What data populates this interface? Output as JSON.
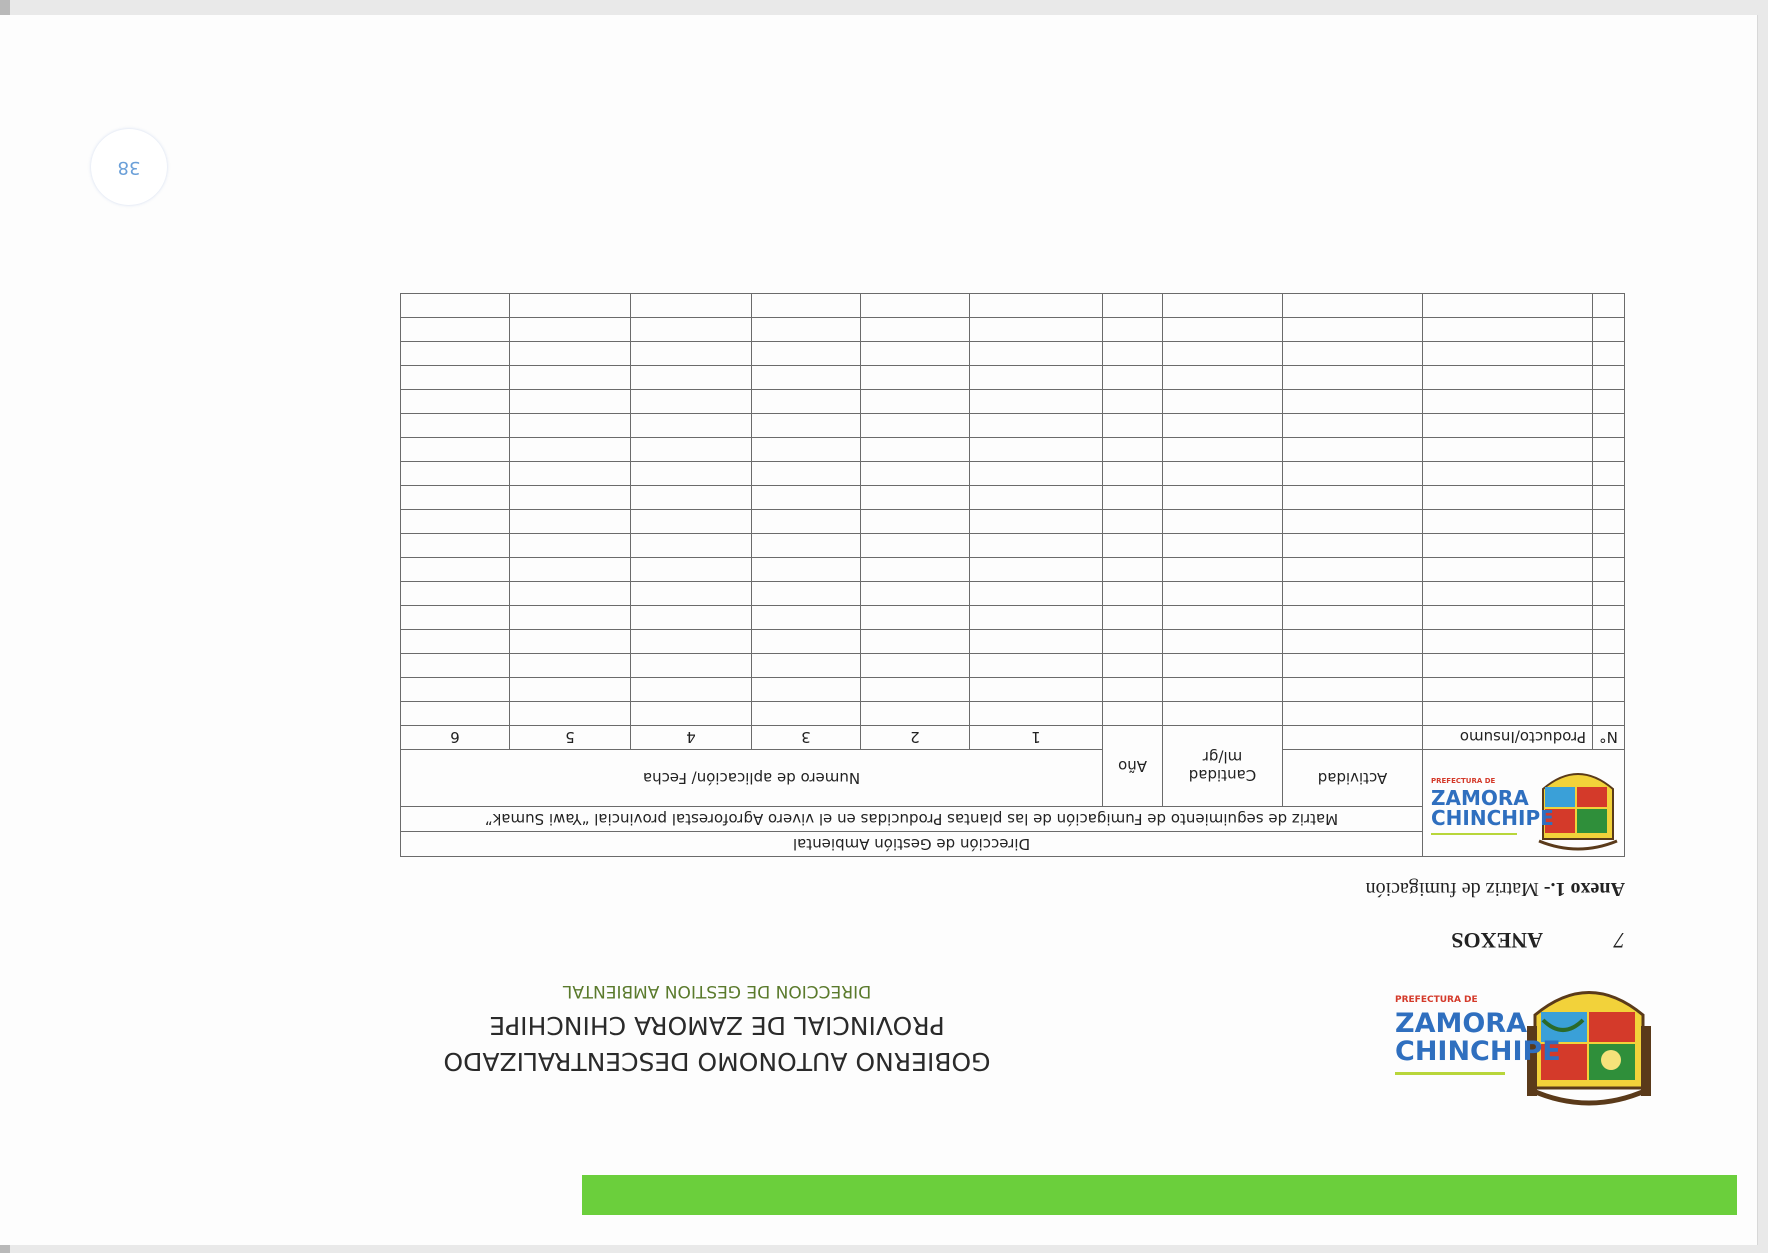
{
  "header": {
    "brand": {
      "prefix": "PREFECTURA DE",
      "line1": "ZAMORA",
      "line2": "CHINCHIPE"
    },
    "title_lines": [
      "GOBIERNO AUTONOMO DESCENTRALIZADO",
      "PROVINCIAL DE ZAMORA CHINCHIPE"
    ],
    "subtitle": "DIRECCION DE GESTION AMBIENTAL"
  },
  "section": {
    "number": "7",
    "title": "ANEXOS"
  },
  "annex": {
    "label": "Anexo 1.-",
    "text": " Matriz de fumigación"
  },
  "matrix": {
    "department": "Dirección de Gestión Ambiental",
    "title": "Matriz de seguimiento de Fumigación de las plantas Producidas en el vivero Agroforestal provincial “Yawi Sumak”",
    "col_activity": "Actividad",
    "col_quantity_line1": "Cantidad",
    "col_quantity_line2": "ml/gr",
    "col_year": "Año",
    "col_applications": "Numero de aplicación/ Fecha",
    "col_no": "N°",
    "col_product": "Producto/Insumo",
    "application_numbers": [
      "1",
      "2",
      "3",
      "4",
      "5",
      "6"
    ],
    "empty_rows": 18
  },
  "page": {
    "number": "38"
  },
  "colors": {
    "green_bar": "#6bcf3c",
    "subtitle": "#5a7a2c",
    "brand_blue": "#2f6fbf"
  }
}
